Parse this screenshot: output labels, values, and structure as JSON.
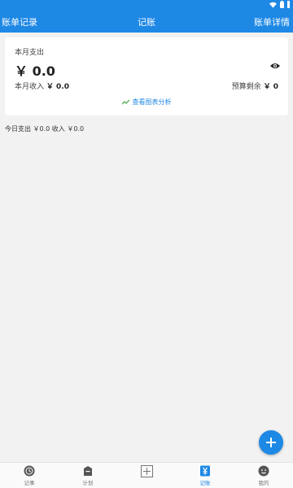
{
  "topbar": {
    "left_label": "账单记录",
    "title": "记账",
    "right_label": "账单详情"
  },
  "summary": {
    "month_expense_label": "本月支出",
    "month_expense_value": "￥ 0.0",
    "month_income_label": "本月收入",
    "month_income_value": "￥ 0.0",
    "budget_label": "预算剩余",
    "budget_value": "￥ 0",
    "analysis_link": "查看图表分析"
  },
  "today_summary": "今日支出 ￥0.0 收入 ￥0.0",
  "bottom_nav": [
    {
      "label": "记事",
      "icon": "clock-icon"
    },
    {
      "label": "计划",
      "icon": "plan-icon"
    },
    {
      "label": "",
      "icon": "add-box-icon"
    },
    {
      "label": "记账",
      "icon": "yen-icon"
    },
    {
      "label": "我的",
      "icon": "profile-icon"
    }
  ],
  "colors": {
    "primary": "#1e88e5",
    "background": "#f2f2f2",
    "accent_green": "#4caf50"
  }
}
